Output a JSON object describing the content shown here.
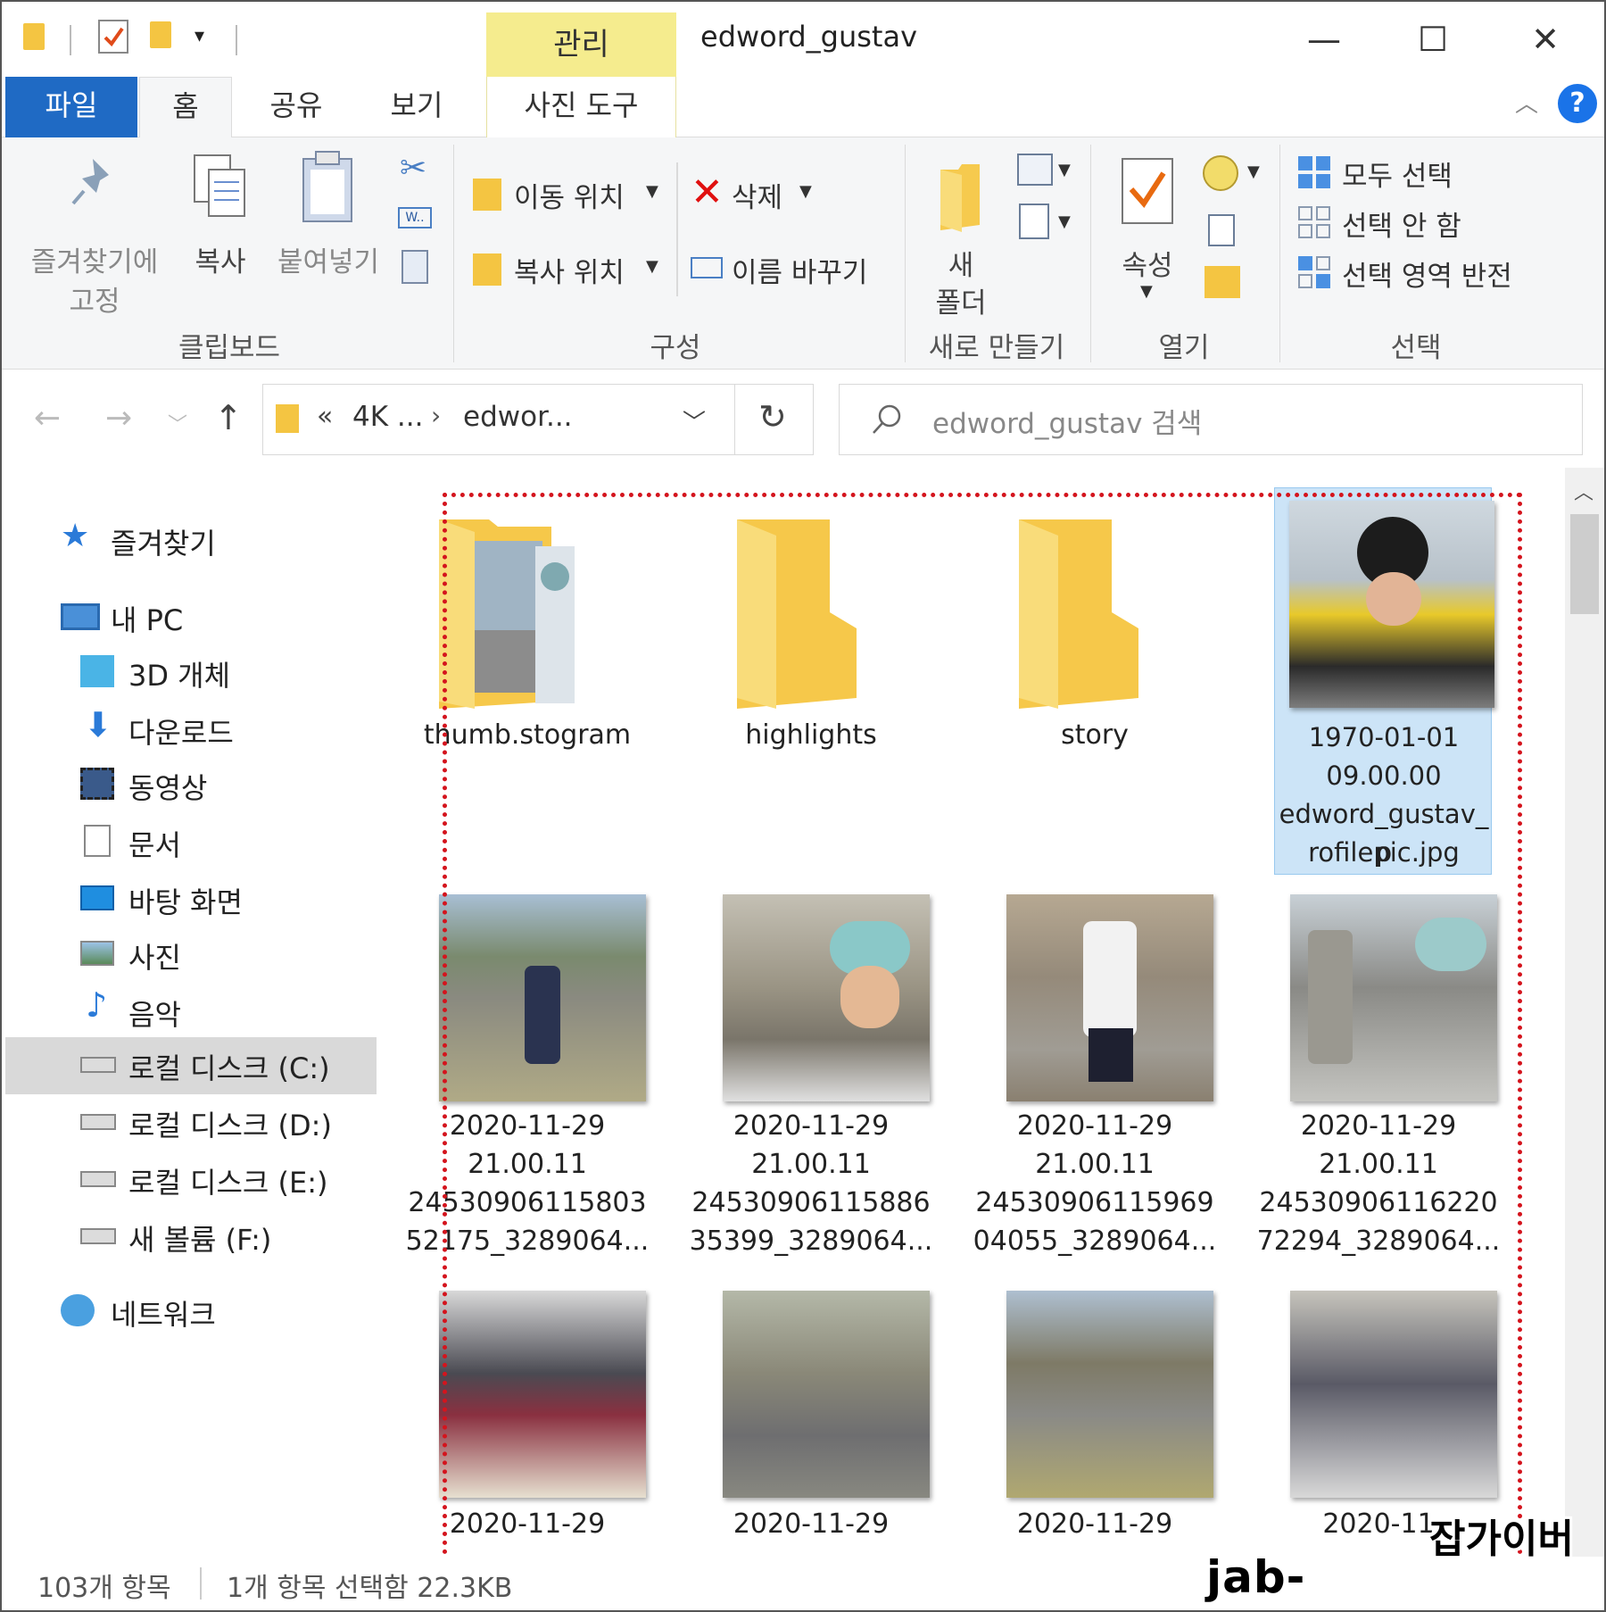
{
  "window": {
    "title": "edword_gustav",
    "manage_tab": "관리"
  },
  "menu_tabs": [
    {
      "label": "파일"
    },
    {
      "label": "홈"
    },
    {
      "label": "공유"
    },
    {
      "label": "보기"
    },
    {
      "label": "사진 도구"
    }
  ],
  "ribbon": {
    "clipboard": {
      "pin_line1": "즐겨찾기에",
      "pin_line2": "고정",
      "copy": "복사",
      "paste": "붙여넣기",
      "group": "클립보드"
    },
    "organize": {
      "move_to": "이동 위치",
      "copy_to": "복사 위치",
      "delete": "삭제",
      "rename": "이름 바꾸기",
      "group": "구성"
    },
    "new": {
      "folder_line1": "새",
      "folder_line2": "폴더",
      "group": "새로 만들기"
    },
    "open": {
      "properties": "속성",
      "group": "열기"
    },
    "select": {
      "select_all": "모두 선택",
      "select_none": "선택 안 함",
      "invert": "선택 영역 반전",
      "group": "선택"
    }
  },
  "address": {
    "chevron": "«",
    "crumb1": "4K ...",
    "crumb2": "edwor...",
    "search_placeholder": "edword_gustav 검색"
  },
  "nav": {
    "favorites": "즐겨찾기",
    "this_pc": "내 PC",
    "objects3d": "3D 개체",
    "downloads": "다운로드",
    "videos": "동영상",
    "documents": "문서",
    "desktop": "바탕 화면",
    "pictures": "사진",
    "music": "음악",
    "disk_c": "로컬 디스크 (C:)",
    "disk_d": "로컬 디스크 (D:)",
    "disk_e": "로컬 디스크 (E:)",
    "volume_f": "새 볼륨 (F:)",
    "network": "네트워크"
  },
  "files": {
    "folders": [
      "thumb.stogram",
      "highlights",
      "story"
    ],
    "selected": {
      "line1": "1970-01-01",
      "line2": "09.00.00",
      "line3": "edword_gustav_p",
      "line4": "rofilepic.jpg"
    },
    "row2": [
      {
        "l1": "2020-11-29",
        "l2": "21.00.11",
        "l3": "24530906115803",
        "l4": "52175_3289064..."
      },
      {
        "l1": "2020-11-29",
        "l2": "21.00.11",
        "l3": "24530906115886",
        "l4": "35399_3289064..."
      },
      {
        "l1": "2020-11-29",
        "l2": "21.00.11",
        "l3": "24530906115969",
        "l4": "04055_3289064..."
      },
      {
        "l1": "2020-11-29",
        "l2": "21.00.11",
        "l3": "24530906116220",
        "l4": "72294_3289064..."
      }
    ],
    "row3": [
      "2020-11-29",
      "2020-11-29",
      "2020-11-29",
      "2020-11"
    ]
  },
  "status": {
    "count": "103개 항목",
    "selection": "1개 항목 선택함 22.3KB"
  },
  "watermark": {
    "line1": "잡가이버",
    "line2": "jab-guyver.co.kr"
  }
}
